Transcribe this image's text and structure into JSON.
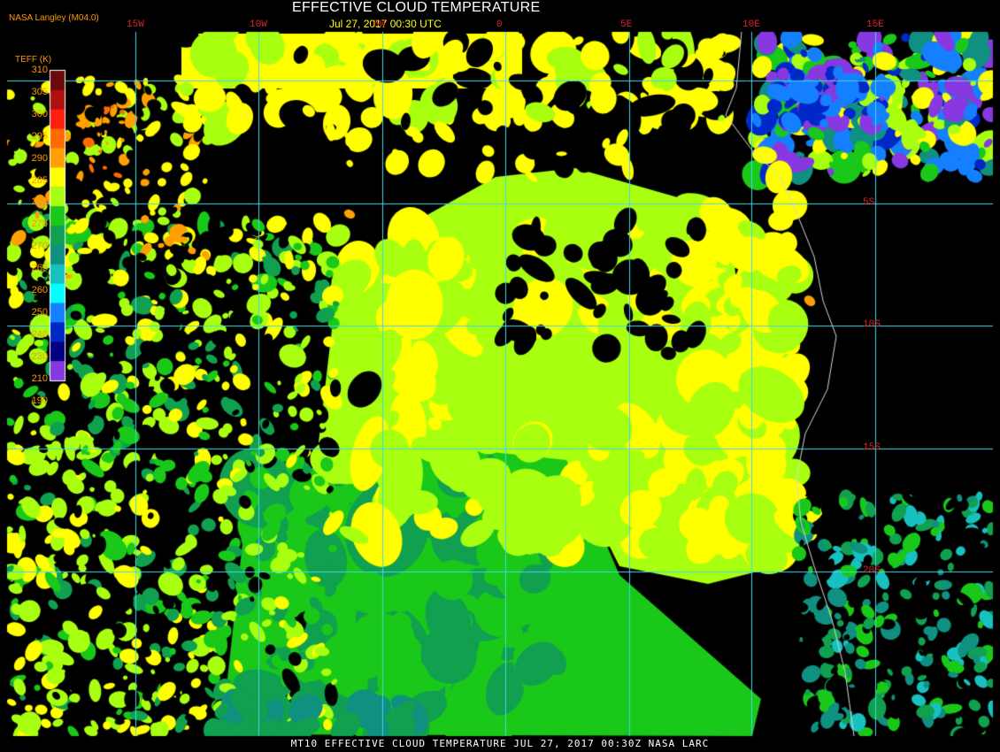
{
  "header": {
    "source": "NASA Langley (M04.0)",
    "title": "EFFECTIVE CLOUD TEMPERATURE",
    "subtitle": "Jul 27, 2017 00:30 UTC"
  },
  "footer": {
    "text": "MT10   EFFECTIVE CLOUD TEMPERATURE    JUL 27, 2017 00:30Z    NASA LARC"
  },
  "legend": {
    "title": "TEFF (K)",
    "ticks": [
      "310",
      "305",
      "300",
      "295",
      "290",
      "285",
      "280",
      "275",
      "270",
      "265",
      "260",
      "250",
      "240",
      "230",
      "210",
      "190"
    ],
    "colors": [
      "#6b0a0a",
      "#b01010",
      "#ff2010",
      "#ff6a00",
      "#ffa000",
      "#ffff00",
      "#a8ff10",
      "#1ac81a",
      "#10a050",
      "#109080",
      "#18c0c0",
      "#00ffff",
      "#1480ff",
      "#0028c8",
      "#000080",
      "#8838e0"
    ]
  },
  "grid": {
    "color": "#3fd8e8",
    "longitudes": [
      "15W",
      "10W",
      "5W",
      "0",
      "5E",
      "10E",
      "15E"
    ],
    "latitudes": [
      "5S",
      "10S",
      "15S",
      "20S"
    ]
  },
  "coastline_color": "#d8d8d8"
}
